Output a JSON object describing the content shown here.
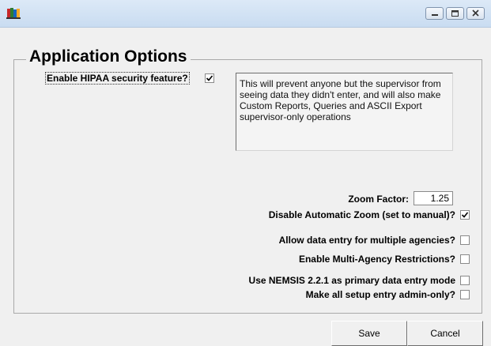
{
  "window": {
    "title": "",
    "icon": "app-books-icon",
    "buttons": [
      "minimize-icon",
      "maximize-icon",
      "close-icon"
    ]
  },
  "options": {
    "group_title": "Application Options",
    "hipaa": {
      "label": "Enable HIPAA security feature?",
      "checked": true
    },
    "hipaa_info": "This will prevent anyone but the supervisor from seeing data they didn't enter, and will also make Custom Reports, Queries and ASCII Export supervisor-only operations",
    "zoom_factor": {
      "label": "Zoom Factor:",
      "value": "1.25"
    },
    "disable_auto_zoom": {
      "label": "Disable Automatic Zoom (set to manual)?",
      "checked": true
    },
    "multi_agency_entry": {
      "label": "Allow data entry for multiple agencies?",
      "checked": false
    },
    "multi_agency_restrictions": {
      "label": "Enable Multi-Agency Restrictions?",
      "checked": false
    },
    "nemsis_primary": {
      "label": "Use NEMSIS 2.2.1 as primary data entry mode",
      "checked": false
    },
    "setup_admin_only": {
      "label": "Make all setup entry admin-only?",
      "checked": false
    }
  },
  "buttons": {
    "save": "Save",
    "cancel": "Cancel"
  }
}
